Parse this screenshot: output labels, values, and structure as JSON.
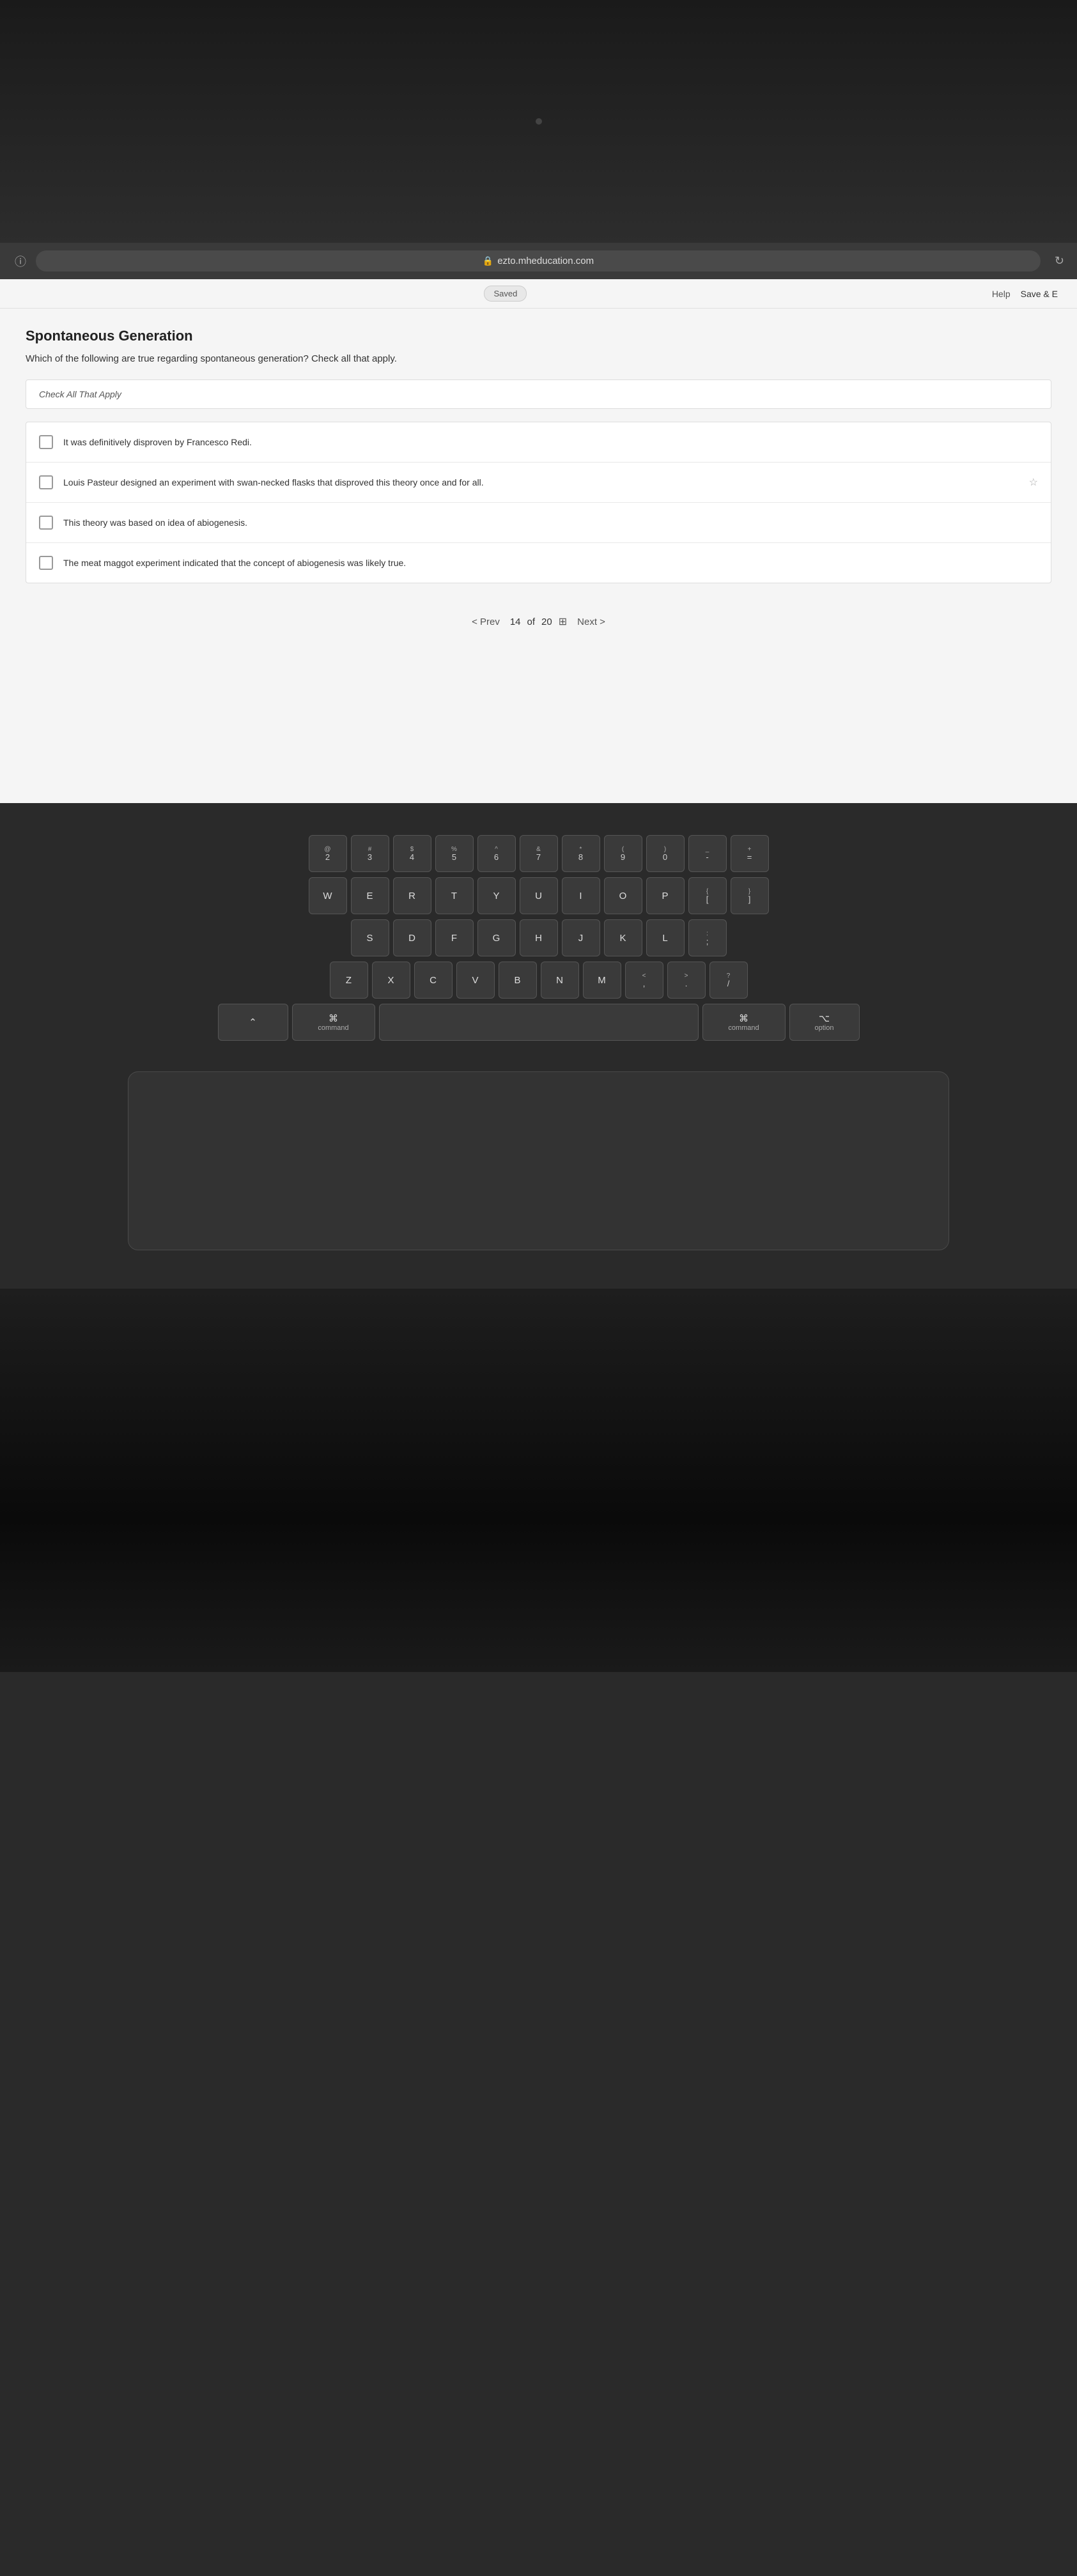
{
  "top_area": {
    "camera_label": "camera"
  },
  "browser": {
    "url": "ezto.mheducation.com",
    "refresh_label": "refresh"
  },
  "website": {
    "saved_label": "Saved",
    "help_label": "Help",
    "save_label": "Save & E",
    "page_title": "Spontaneous Generation",
    "question_text": "Which of the following are true regarding spontaneous generation? Check all that apply.",
    "check_all_label": "Check All That Apply",
    "options": [
      {
        "id": "opt1",
        "text": "It was definitively disproven by Francesco Redi.",
        "checked": false
      },
      {
        "id": "opt2",
        "text": "Louis Pasteur designed an experiment with swan-necked flasks that disproved this theory once and for all.",
        "checked": false
      },
      {
        "id": "opt3",
        "text": "This theory was based on idea of abiogenesis.",
        "checked": false
      },
      {
        "id": "opt4",
        "text": "The meat maggot experiment indicated that the concept of abiogenesis was likely true.",
        "checked": false
      }
    ],
    "pagination": {
      "prev_label": "< Prev",
      "current_page": "14",
      "total_pages": "20",
      "of_label": "of",
      "next_label": "Next >",
      "grid_icon": "⊞"
    }
  },
  "keyboard": {
    "rows": [
      {
        "keys": [
          {
            "top": "@",
            "bottom": "2"
          },
          {
            "top": "#",
            "bottom": "3"
          },
          {
            "top": "$",
            "bottom": "4"
          },
          {
            "top": "%",
            "bottom": "5"
          },
          {
            "top": "^",
            "bottom": "6"
          },
          {
            "top": "&",
            "bottom": "7"
          },
          {
            "top": "*",
            "bottom": "8"
          },
          {
            "top": "(",
            "bottom": "9"
          },
          {
            "top": ")",
            "bottom": "0"
          },
          {
            "top": "_",
            "bottom": "-"
          },
          {
            "top": "+",
            "bottom": "="
          }
        ]
      },
      {
        "keys": [
          {
            "main": "W"
          },
          {
            "main": "E"
          },
          {
            "main": "R"
          },
          {
            "main": "T"
          },
          {
            "main": "Y"
          },
          {
            "main": "U"
          },
          {
            "main": "I"
          },
          {
            "main": "O"
          },
          {
            "main": "P"
          },
          {
            "top": "{",
            "bottom": "["
          },
          {
            "top": "}",
            "bottom": "]"
          }
        ]
      },
      {
        "keys": [
          {
            "main": "S"
          },
          {
            "main": "D"
          },
          {
            "main": "F"
          },
          {
            "main": "G"
          },
          {
            "main": "H"
          },
          {
            "main": "J"
          },
          {
            "main": "K"
          },
          {
            "main": "L"
          },
          {
            "top": ":",
            "bottom": ";"
          }
        ]
      },
      {
        "keys": [
          {
            "main": "Z"
          },
          {
            "main": "X"
          },
          {
            "main": "C"
          },
          {
            "main": "V"
          },
          {
            "main": "B"
          },
          {
            "main": "N"
          },
          {
            "main": "M"
          },
          {
            "top": "<",
            "bottom": ","
          },
          {
            "top": ">",
            "bottom": "."
          },
          {
            "top": "?",
            "bottom": "/"
          }
        ]
      },
      {
        "keys": [
          {
            "main": "⌃",
            "label": "ctrl"
          },
          {
            "main": "⌘",
            "label": "command"
          },
          {
            "main": "",
            "label": "space"
          },
          {
            "main": "⌘",
            "label": "command"
          },
          {
            "main": "⌥",
            "label": "option"
          }
        ]
      }
    ]
  }
}
